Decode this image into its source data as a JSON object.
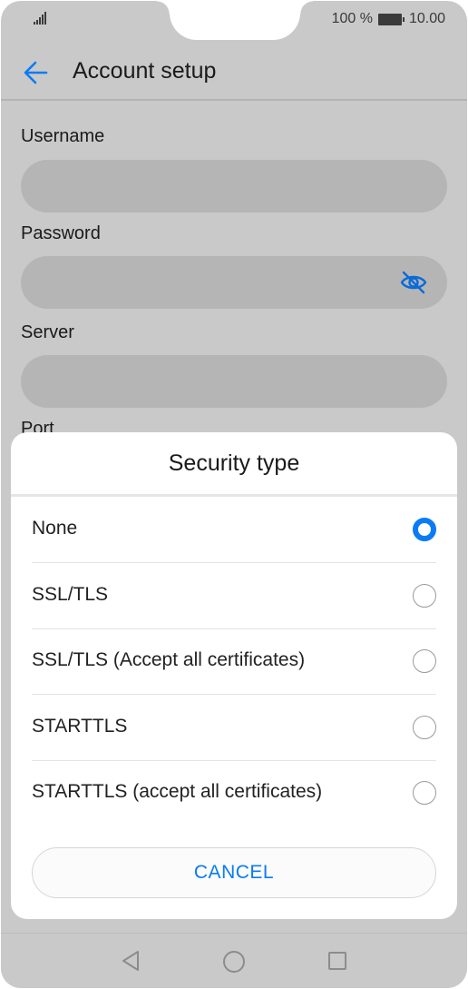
{
  "status_bar": {
    "battery_percent": "100 %",
    "time": "10.00"
  },
  "header": {
    "title": "Account setup",
    "back_icon": "arrow-left-icon"
  },
  "form": {
    "username_label": "Username",
    "username_value": "",
    "password_label": "Password",
    "password_value": "",
    "password_toggle_icon": "eye-off-icon",
    "server_label": "Server",
    "server_value": "",
    "port_label": "Port"
  },
  "dialog": {
    "title": "Security type",
    "options": [
      {
        "label": "None",
        "selected": true
      },
      {
        "label": "SSL/TLS",
        "selected": false
      },
      {
        "label": "SSL/TLS (Accept all certificates)",
        "selected": false
      },
      {
        "label": "STARTTLS",
        "selected": false
      },
      {
        "label": "STARTTLS (accept all certificates)",
        "selected": false
      }
    ],
    "cancel_label": "CANCEL"
  },
  "nav": {
    "back_icon": "triangle-back-icon",
    "home_icon": "circle-home-icon",
    "recent_icon": "square-recent-icon"
  },
  "colors": {
    "accent": "#0a7bf5",
    "overlay_background": "#c9c9c9",
    "dialog_background": "#ffffff"
  }
}
